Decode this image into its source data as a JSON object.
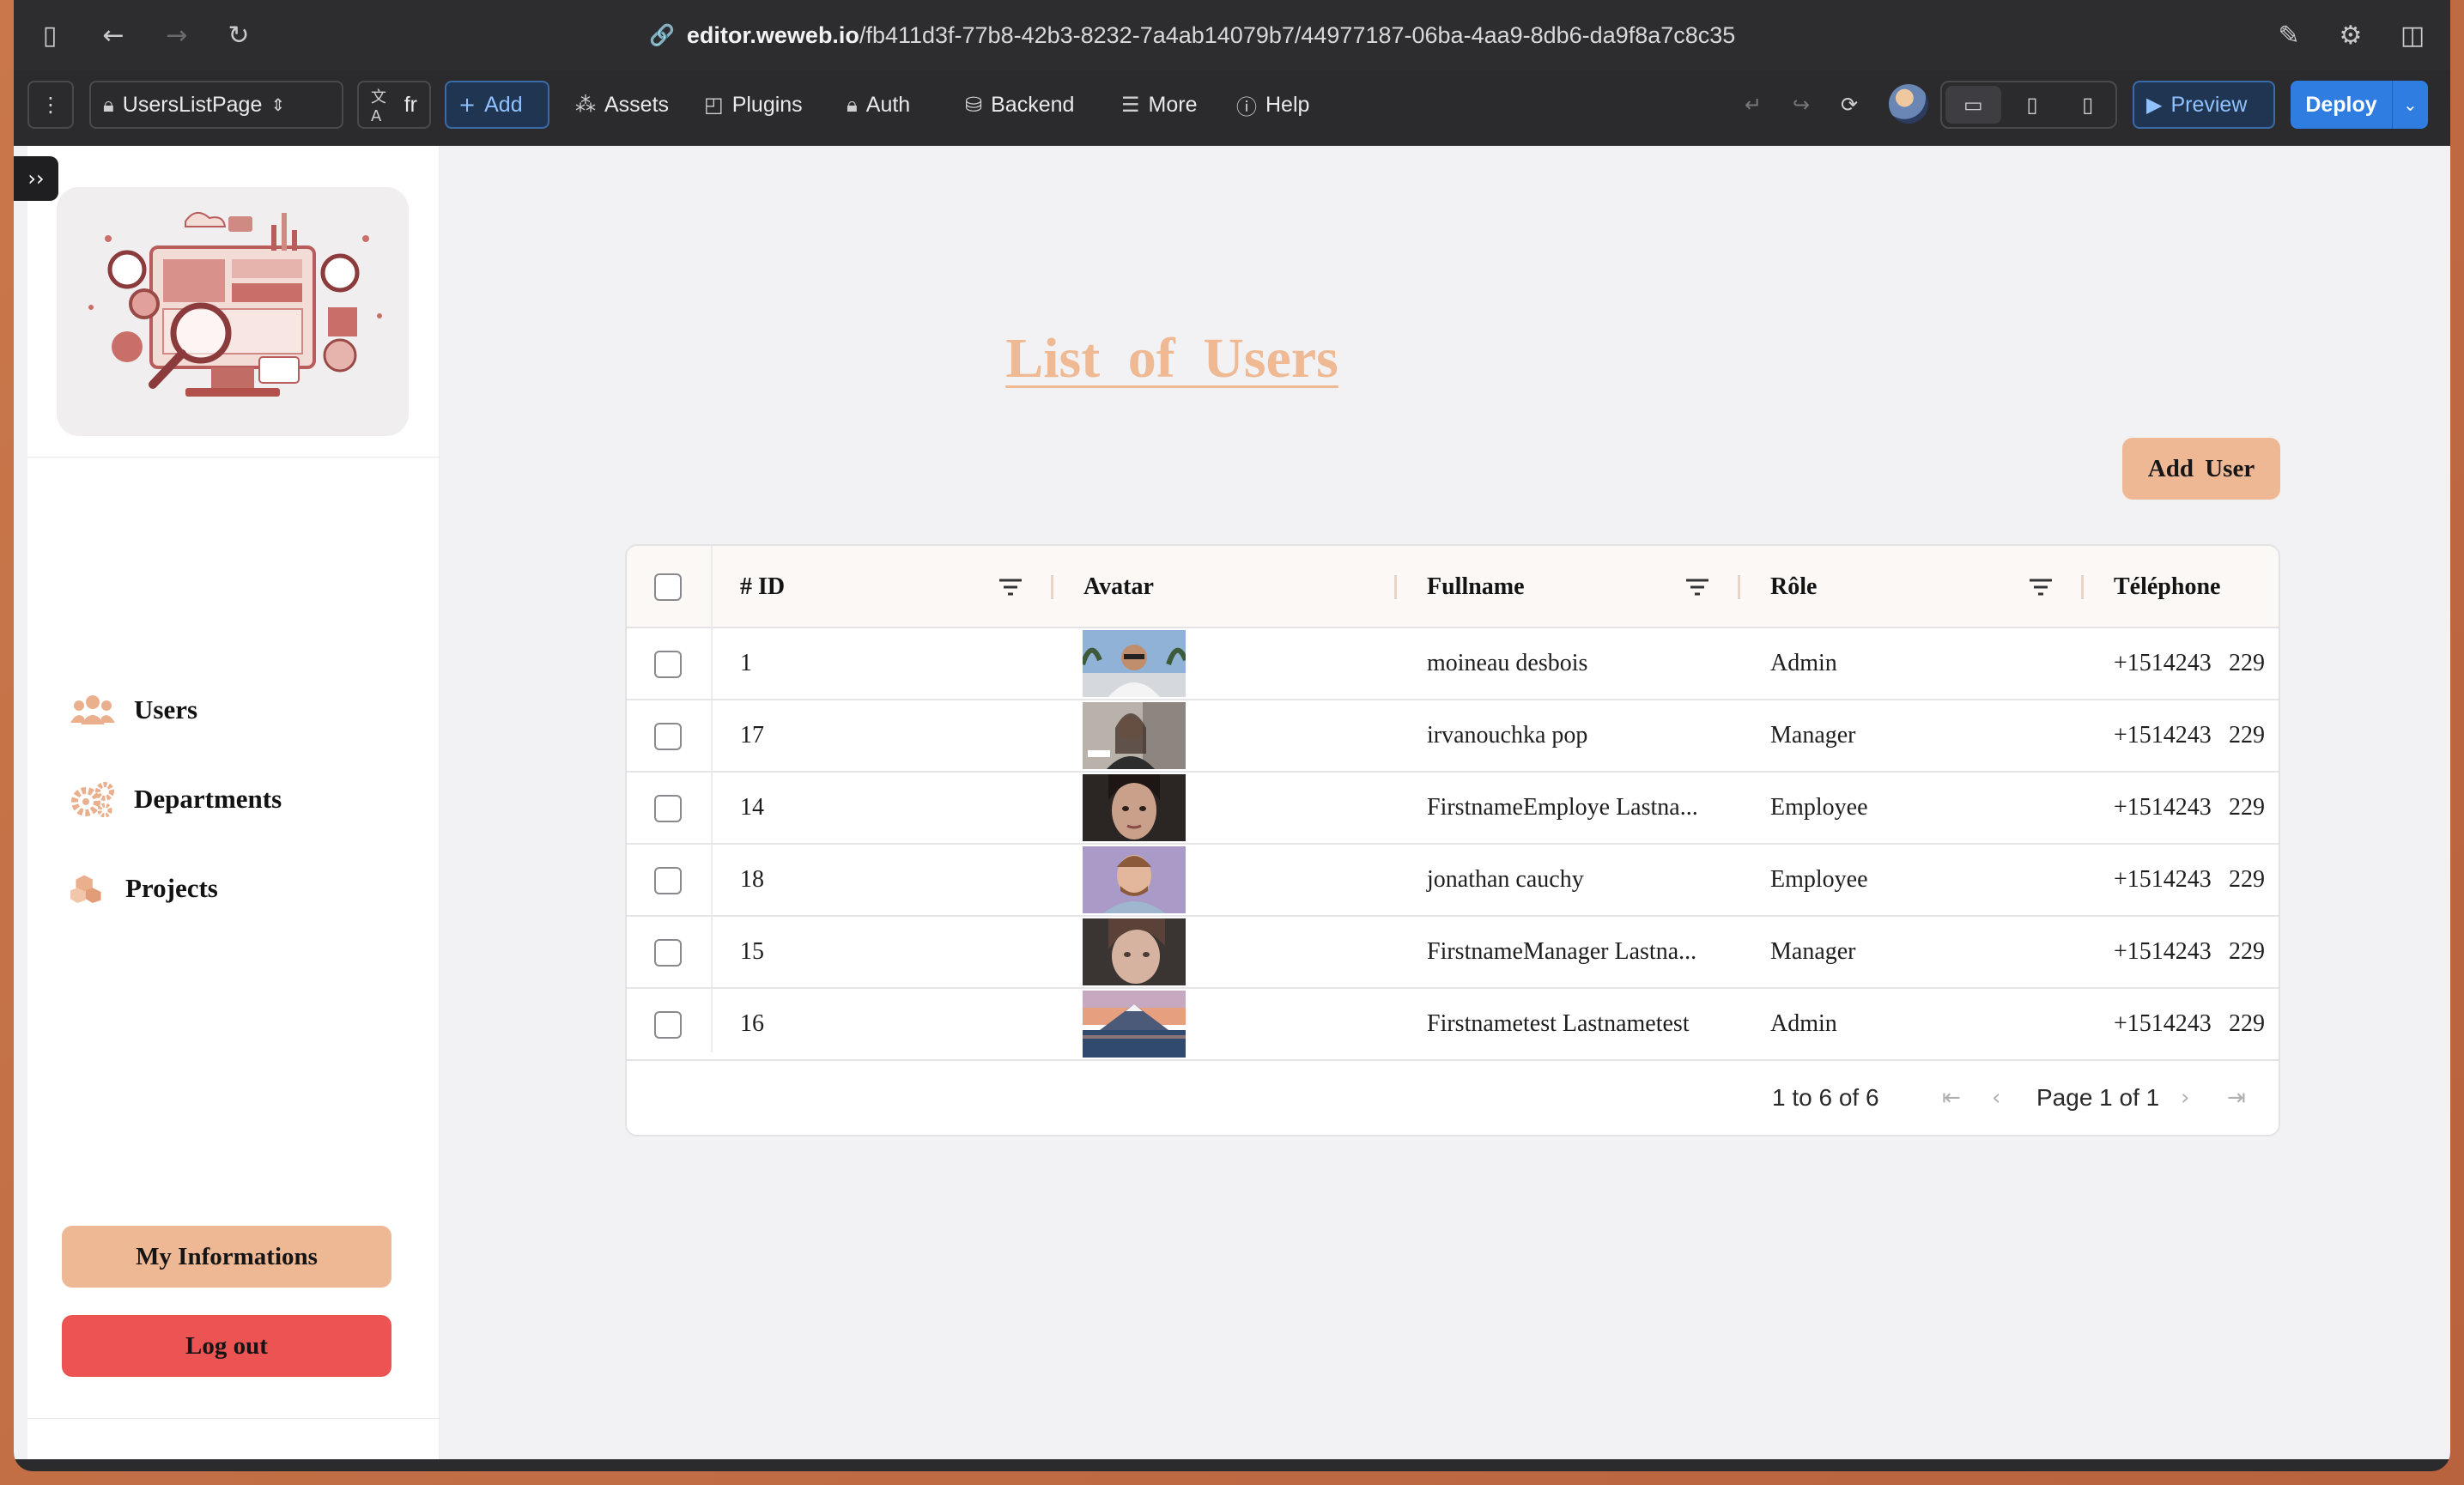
{
  "browser": {
    "url_host": "editor.weweb.io",
    "url_path": "/fb411d3f-77b8-42b3-8232-7a4ab14079b7/44977187-06ba-4aa9-8db6-da9f8a7c8c35"
  },
  "toolbar": {
    "page_selector": "UsersListPage",
    "language": "fr",
    "add": "Add",
    "assets": "Assets",
    "plugins": "Plugins",
    "auth": "Auth",
    "backend": "Backend",
    "more": "More",
    "help": "Help",
    "preview": "Preview",
    "deploy": "Deploy"
  },
  "sidebar": {
    "expand_glyph": "››",
    "nav": [
      {
        "label": "Users",
        "icon": "users-icon"
      },
      {
        "label": "Departments",
        "icon": "gears-icon"
      },
      {
        "label": "Projects",
        "icon": "cubes-icon"
      }
    ],
    "my_info": "My  Informations",
    "logout": "Log  out"
  },
  "main": {
    "title": "List  of  Users",
    "add_user": "Add  User"
  },
  "table": {
    "columns": [
      "# ID",
      "Avatar",
      "Fullname",
      "Rôle",
      "Téléphone"
    ],
    "rows": [
      {
        "id": "1",
        "fullname": "moineau  desbois",
        "role": "Admin",
        "phone": "+1514243",
        "phone_ext": "229"
      },
      {
        "id": "17",
        "fullname": "irvanouchka  pop",
        "role": "Manager",
        "phone": "+1514243",
        "phone_ext": "229"
      },
      {
        "id": "14",
        "fullname": "FirstnameEmploye  Lastna...",
        "role": "Employee",
        "phone": "+1514243",
        "phone_ext": "229"
      },
      {
        "id": "18",
        "fullname": "jonathan  cauchy",
        "role": "Employee",
        "phone": "+1514243",
        "phone_ext": "229"
      },
      {
        "id": "15",
        "fullname": "FirstnameManager  Lastna...",
        "role": "Manager",
        "phone": "+1514243",
        "phone_ext": "229"
      },
      {
        "id": "16",
        "fullname": "Firstnametest  Lastnametest",
        "role": "Admin",
        "phone": "+1514243",
        "phone_ext": "229"
      }
    ],
    "range_text": "1 to 6 of 6",
    "page_text": "Page 1 of 1"
  },
  "colors": {
    "accent_peach": "#efb894",
    "logout_red": "#ec5353",
    "deploy_blue": "#2f7de1"
  }
}
